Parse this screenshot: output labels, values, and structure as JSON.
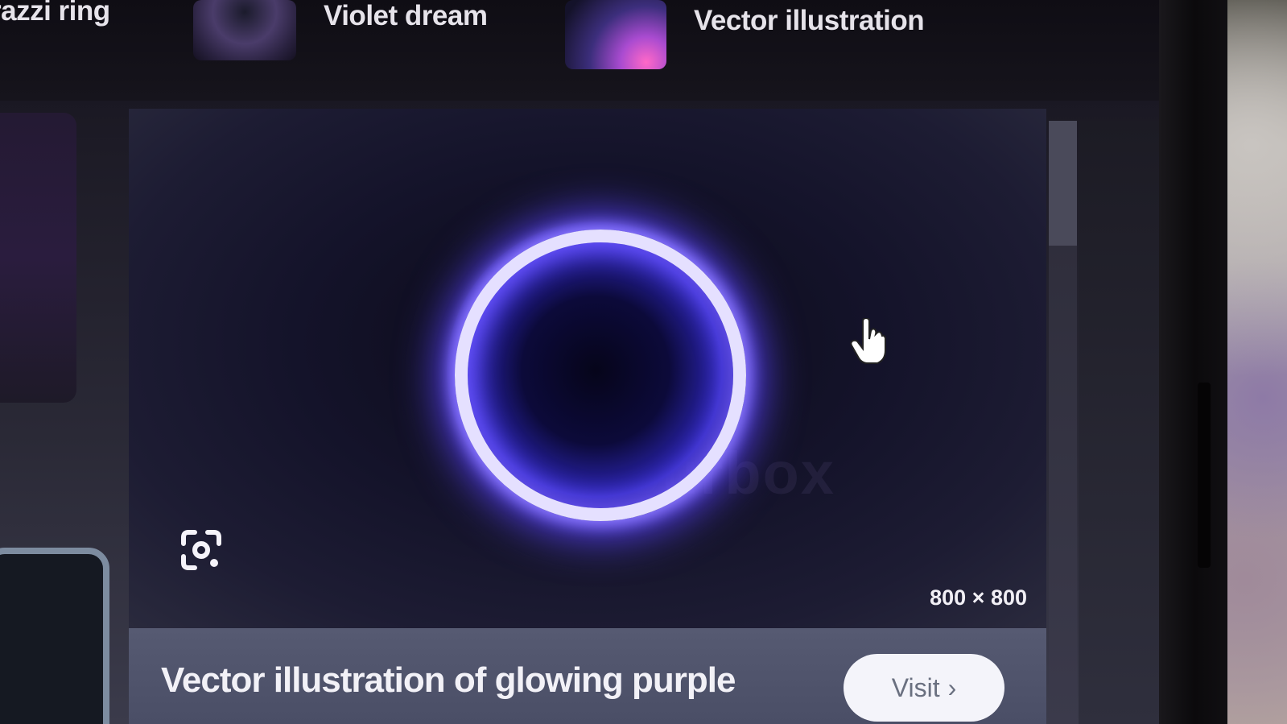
{
  "related": [
    {
      "label": "razzi ring"
    },
    {
      "label": "Violet dream"
    },
    {
      "label": "Vector illustration"
    }
  ],
  "preview": {
    "watermark": "Colourbox",
    "dimensions": "800 × 800"
  },
  "info": {
    "caption": "Vector illustration of glowing purple",
    "visit_label": "Visit",
    "visit_chevron": "›"
  },
  "icons": {
    "lens": "google-lens-icon",
    "cursor": "hand-pointer-icon"
  },
  "colors": {
    "ring_glow": "#5b45ff",
    "ring_core": "#e5e0ff"
  }
}
